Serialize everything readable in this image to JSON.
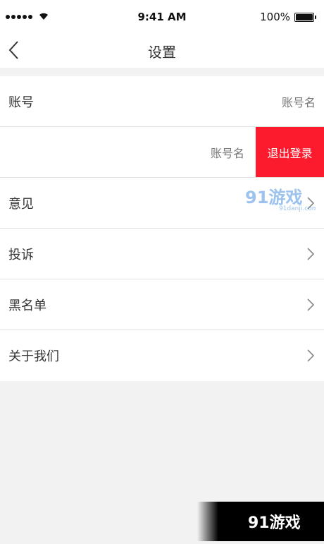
{
  "status_bar": {
    "time": "9:41 AM",
    "battery": "100%"
  },
  "nav": {
    "title": "设置"
  },
  "rows": [
    {
      "label": "账号",
      "value": "账号名"
    },
    {
      "label": "",
      "value": "账号名",
      "action": "退出登录"
    },
    {
      "label": "意见"
    },
    {
      "label": "投诉"
    },
    {
      "label": "黑名单"
    },
    {
      "label": "关于我们"
    }
  ],
  "watermark": {
    "brand": "91游戏",
    "site": "91danji.com"
  },
  "colors": {
    "accent": "#fc1b2c",
    "background": "#f2f2f2",
    "watermark_blue": "#4a90e2"
  }
}
